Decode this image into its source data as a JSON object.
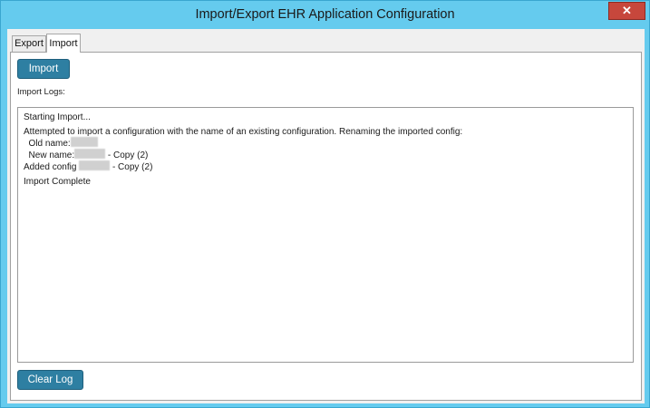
{
  "window": {
    "title": "Import/Export EHR Application Configuration",
    "close_glyph": "✕"
  },
  "tabs": [
    {
      "label": "Export",
      "selected": false
    },
    {
      "label": "Import",
      "selected": true
    }
  ],
  "import_panel": {
    "import_button_label": "Import",
    "logs_label": "Import Logs:",
    "clear_button_label": "Clear Log",
    "log": {
      "starting": "Starting Import...",
      "attempted": "Attempted to import a configuration with the name of an existing configuration. Renaming the imported config:",
      "old_name_label": "  Old name:",
      "new_name_label": "  New name:",
      "new_name_suffix": " - Copy (2)",
      "added_label": "Added config ",
      "added_suffix": " - Copy (2)",
      "complete": "Import Complete"
    }
  },
  "colors": {
    "titlebar": "#65cbee",
    "accent_button": "#2e7fa2",
    "close_button": "#c7473c"
  }
}
